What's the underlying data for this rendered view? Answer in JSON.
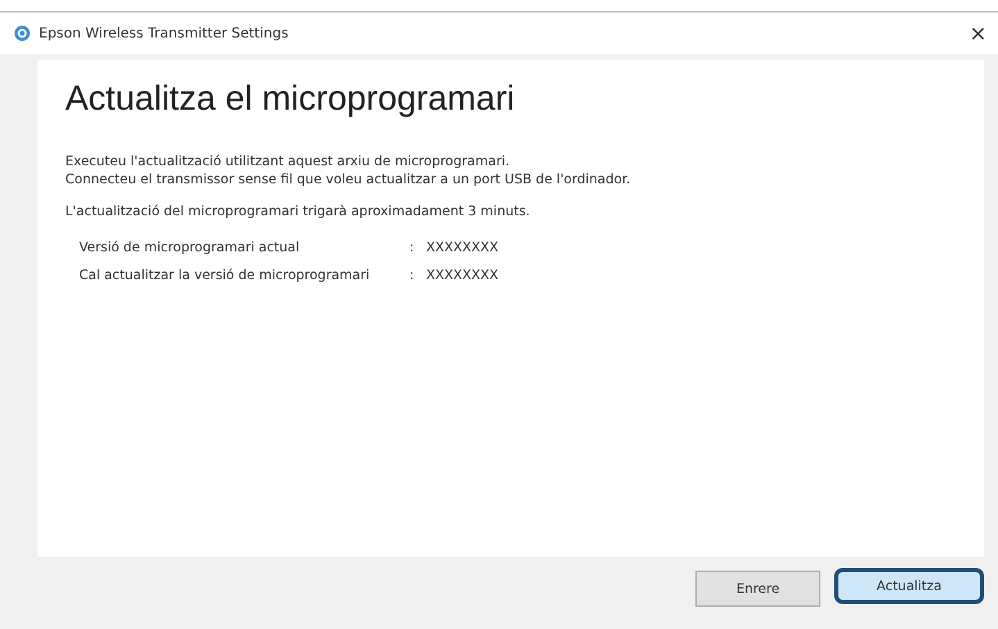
{
  "window": {
    "title": "Epson Wireless Transmitter Settings",
    "close": "×"
  },
  "heading": "Actualitza el microprogramari",
  "paragraphs": [
    [
      "Executeu l'actualització utilitzant aquest arxiu de microprogramari.",
      "Connecteu el transmissor sense fil que voleu actualitzar a un port USB de l'ordinador."
    ],
    [
      "L'actualització del microprogramari trigarà aproximadament 3 minuts."
    ]
  ],
  "details": [
    {
      "label": "Versió de microprogramari actual",
      "separator": ":",
      "value": "XXXXXXXX"
    },
    {
      "label": "Cal actualitzar la versió de microprogramari",
      "separator": ":",
      "value": "XXXXXXXX"
    }
  ],
  "buttons": [
    {
      "label": "Enrere",
      "highlighted": false
    },
    {
      "label": "Actualitza",
      "highlighted": true
    }
  ]
}
